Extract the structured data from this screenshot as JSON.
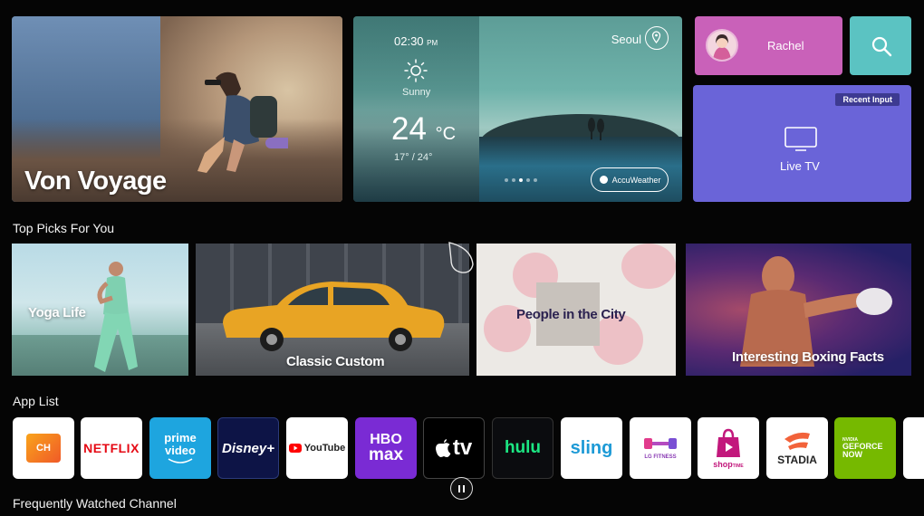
{
  "hero": {
    "title": "Von Voyage"
  },
  "weather": {
    "time": "02:30",
    "ampm": "PM",
    "condition": "Sunny",
    "temp": "24",
    "unit": "°C",
    "range": "17° / 24°",
    "city": "Seoul",
    "provider": "AccuWeather"
  },
  "profile": {
    "name": "Rachel"
  },
  "live_tv": {
    "label": "Live TV",
    "badge": "Recent Input"
  },
  "sections": {
    "top_picks": "Top Picks For You",
    "app_list": "App List",
    "frequent": "Frequently Watched Channel"
  },
  "picks": [
    {
      "label": "Yoga Life"
    },
    {
      "label": "Classic Custom"
    },
    {
      "label": "People in the City"
    },
    {
      "label": "Interesting Boxing Facts"
    }
  ],
  "apps": [
    {
      "name": "CH",
      "icon": "channels-icon"
    },
    {
      "name": "NETFLIX",
      "icon": "netflix-logo"
    },
    {
      "name": "prime video",
      "line1": "prime",
      "line2": "video",
      "icon": "prime-video-logo"
    },
    {
      "name": "Disney+",
      "icon": "disney-plus-logo"
    },
    {
      "name": "YouTube",
      "icon": "youtube-logo"
    },
    {
      "name": "HBO max",
      "line1": "HBO",
      "line2": "max",
      "icon": "hbo-max-logo"
    },
    {
      "name": "tv",
      "icon": "apple-tv-logo"
    },
    {
      "name": "hulu",
      "icon": "hulu-logo"
    },
    {
      "name": "sling",
      "icon": "sling-logo"
    },
    {
      "name": "LG FITNESS",
      "icon": "lg-fitness-logo"
    },
    {
      "name": "shop",
      "sub": "TIME",
      "icon": "shop-time-logo"
    },
    {
      "name": "STADIA",
      "icon": "stadia-logo"
    },
    {
      "name": "GEFORCE NOW",
      "line0": "NVIDIA",
      "line1": "GEFORCE",
      "line2": "NOW",
      "icon": "geforce-now-logo"
    }
  ],
  "colors": {
    "profile_bg": "#c961b9",
    "search_bg": "#5bc3c2",
    "live_tv_bg": "#6a64d8",
    "netflix_red": "#e50914",
    "prime_blue": "#1ea5df",
    "hbo_purple": "#7a2bd4",
    "hulu_green": "#1ce783",
    "geforce_green": "#76b900"
  }
}
